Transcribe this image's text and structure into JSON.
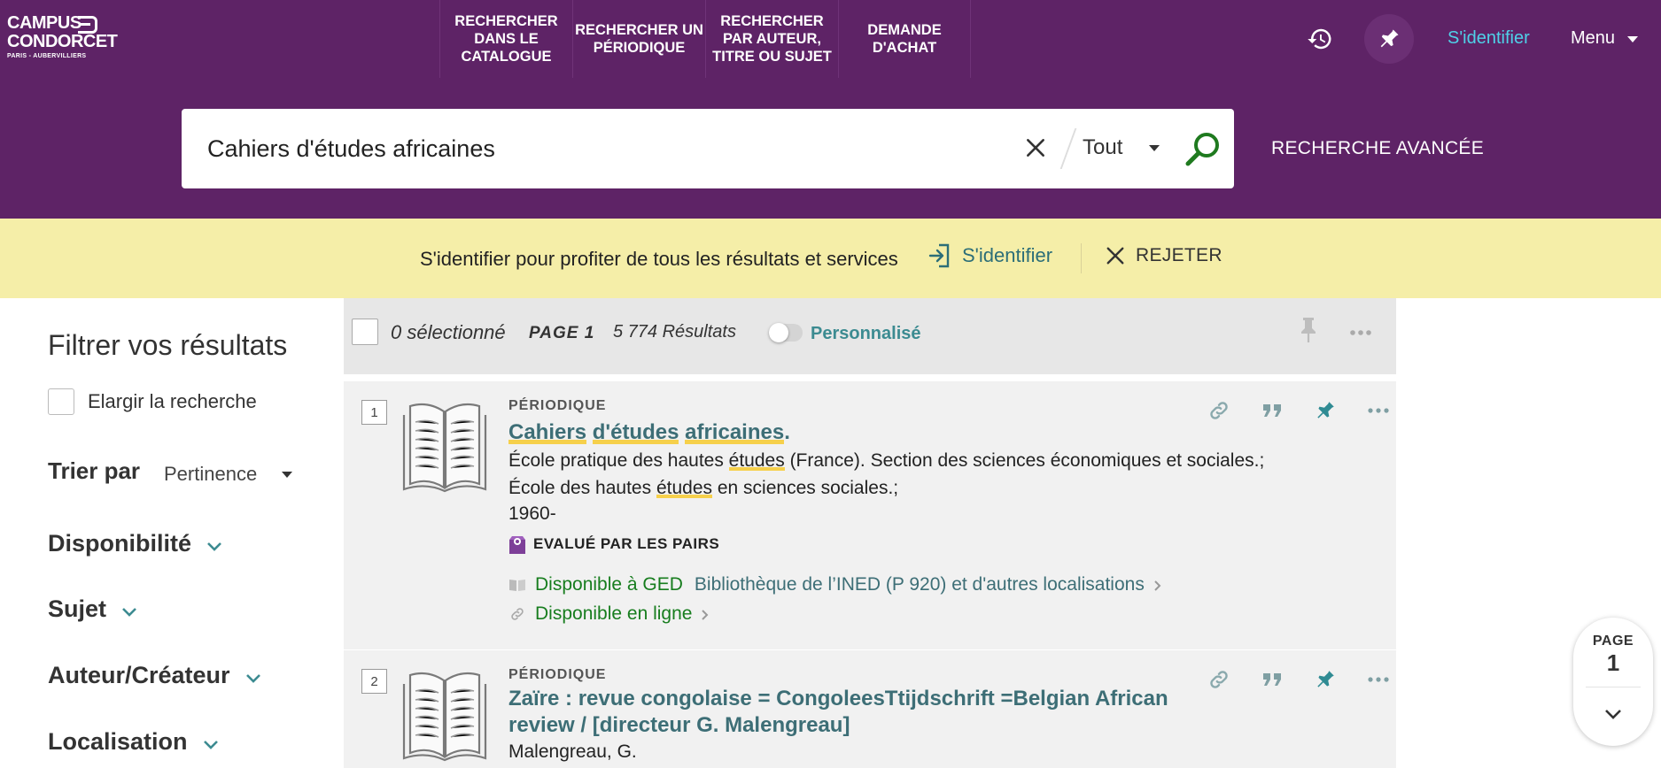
{
  "header": {
    "logo": {
      "line1": "CAMPUS",
      "line2": "CONDORCET",
      "line3": "PARIS - AUBERVILLIERS"
    },
    "nav": [
      {
        "label": "RECHERCHER DANS LE CATALOGUE"
      },
      {
        "label": "RECHERCHER UN PÉRIODIQUE"
      },
      {
        "label": "RECHERCHER PAR AUTEUR, TITRE OU SUJET"
      },
      {
        "label": "DEMANDE D'ACHAT"
      }
    ],
    "signin_label": "S'identifier",
    "menu_label": "Menu",
    "history_icon": "history-icon",
    "pin_icon": "pin-icon"
  },
  "search": {
    "query": "Cahiers d'études africaines",
    "scope": "Tout",
    "advanced_label": "RECHERCHE AVANCÉE"
  },
  "banner": {
    "message": "S'identifier pour profiter de tous les résultats et services",
    "signin_label": "S'identifier",
    "reject_label": "REJETER"
  },
  "filters": {
    "title": "Filtrer vos résultats",
    "expand_label": "Elargir la recherche",
    "sort_label": "Trier par",
    "sort_value": "Pertinence",
    "facets": [
      {
        "label": "Disponibilité"
      },
      {
        "label": "Sujet"
      },
      {
        "label": "Auteur/Créateur"
      },
      {
        "label": "Localisation"
      }
    ]
  },
  "results_bar": {
    "selected": "0 sélectionné",
    "page": "PAGE 1",
    "count": "5 774 Résultats",
    "personalized": "Personnalisé"
  },
  "results": [
    {
      "number": "1",
      "type": "PÉRIODIQUE",
      "title_a": "Cahiers",
      "title_b": "d'",
      "title_c": "études",
      "title_d": "africaines",
      "title_e": ".",
      "authors_a": "École pratique des hautes ",
      "authors_b": "études",
      "authors_c": " (France). Section des sciences économiques et sociales.; École des hautes ",
      "authors_d": "études",
      "authors_e": " en sciences sociales.;",
      "date": "1960-",
      "peer_reviewed": "EVALUÉ PAR LES PAIRS",
      "availability_physical": "Disponible à GED",
      "location": "Bibliothèque de l’INED (P 920) et d'autres localisations",
      "availability_online": "Disponible en ligne"
    },
    {
      "number": "2",
      "type": "PÉRIODIQUE",
      "title": "Zaïre : revue congolaise = CongoleesTtijdschrift =Belgian African review / [directeur G. Malengreau]",
      "authors": "Malengreau, G."
    }
  ],
  "page_badge": {
    "label": "PAGE",
    "number": "1"
  },
  "colors": {
    "header_bg": "#5e2366",
    "banner_bg": "#f5eea8",
    "link_teal": "#3d6e76",
    "available_green": "#177d1e",
    "signin_cyan": "#4fd1e8",
    "highlight": "#f6d04b"
  }
}
